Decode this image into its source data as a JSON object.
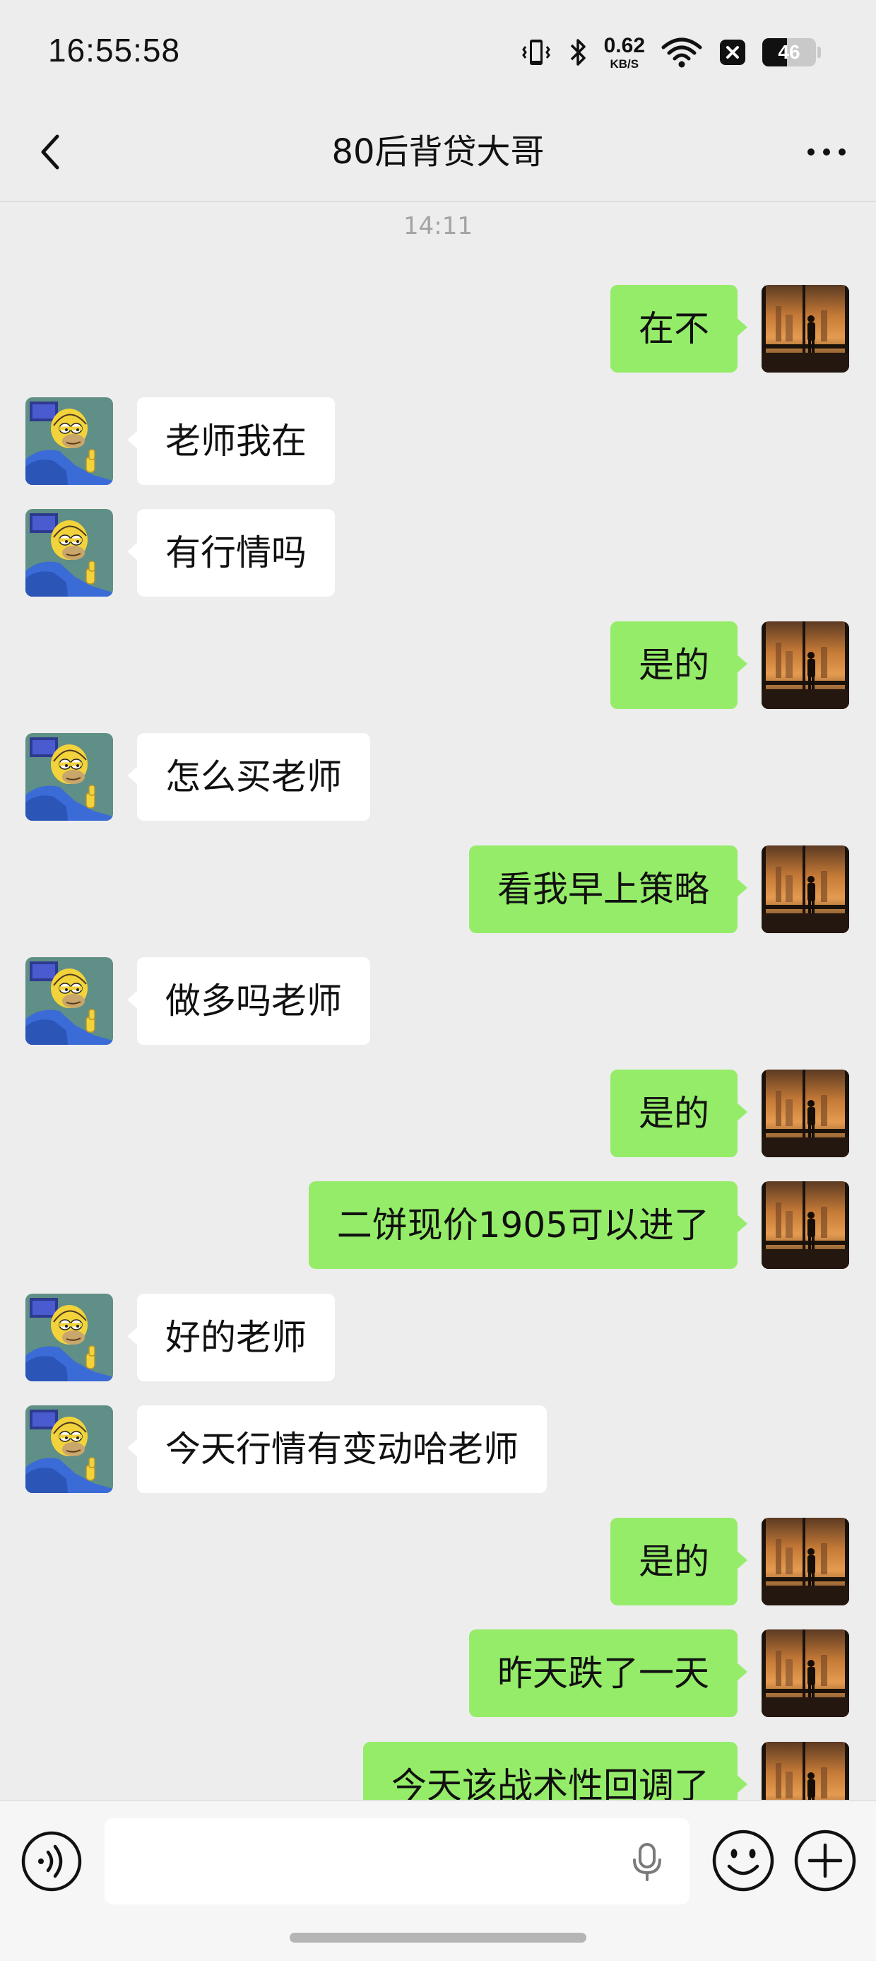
{
  "status_bar": {
    "time": "16:55:58",
    "net_speed_value": "0.62",
    "net_speed_unit": "KB/S",
    "battery_level": "46",
    "battery_fraction": 0.46,
    "icons": [
      "vibrate-icon",
      "bluetooth-icon",
      "wifi-icon",
      "notification-x-icon",
      "battery-icon"
    ]
  },
  "header": {
    "title": "80后背贷大哥",
    "back_icon": "chevron-left-icon",
    "more_icon": "more-dots-icon"
  },
  "conversation": {
    "time_divider": "14:11",
    "colors": {
      "sent_bubble": "#95ec69",
      "received_bubble": "#ffffff",
      "background": "#ededed"
    },
    "messages": [
      {
        "side": "sent",
        "text": "在不"
      },
      {
        "side": "received",
        "text": "老师我在"
      },
      {
        "side": "received",
        "text": "有行情吗"
      },
      {
        "side": "sent",
        "text": "是的"
      },
      {
        "side": "received",
        "text": "怎么买老师"
      },
      {
        "side": "sent",
        "text": "看我早上策略"
      },
      {
        "side": "received",
        "text": "做多吗老师"
      },
      {
        "side": "sent",
        "text": "是的"
      },
      {
        "side": "sent",
        "text": "二饼现价1905可以进了"
      },
      {
        "side": "received",
        "text": "好的老师"
      },
      {
        "side": "received",
        "text": "今天行情有变动哈老师"
      },
      {
        "side": "sent",
        "text": "是的"
      },
      {
        "side": "sent",
        "text": "昨天跌了一天"
      },
      {
        "side": "sent",
        "text": "今天该战术性回调了"
      }
    ]
  },
  "input_bar": {
    "value": "",
    "icons": [
      "voice-icon",
      "microphone-icon",
      "emoji-icon",
      "plus-icon"
    ]
  }
}
